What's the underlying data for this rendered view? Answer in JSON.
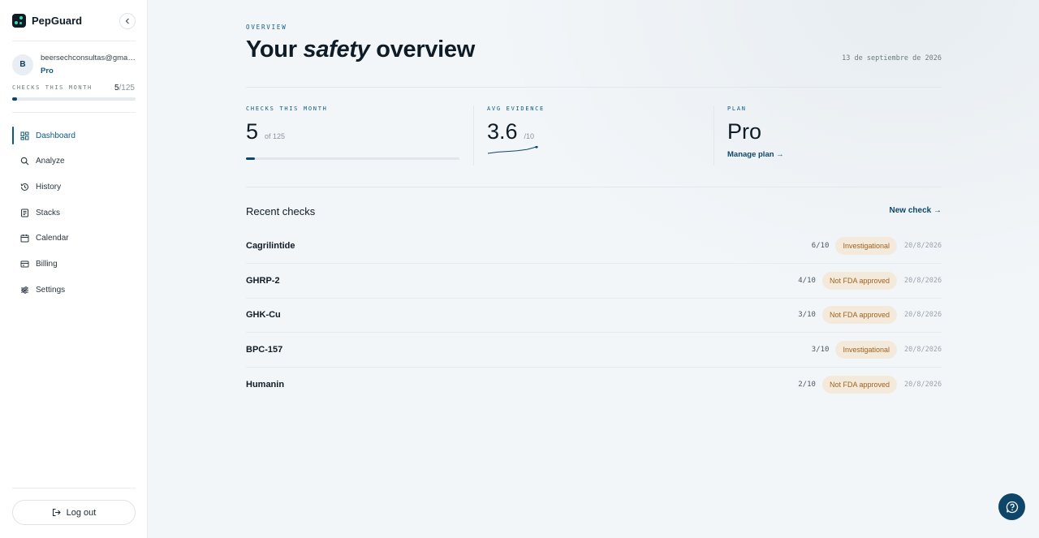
{
  "brand": {
    "name": "PepGuard"
  },
  "user": {
    "initial": "B",
    "email": "beersechconsultas@gmail.com",
    "plan": "Pro"
  },
  "sidebar": {
    "checks_label": "CHECKS THIS MONTH",
    "checks_used": "5",
    "checks_total": "/125",
    "checks_progress": 0.04,
    "nav": [
      {
        "label": "Dashboard",
        "icon": "grid-icon",
        "active": true
      },
      {
        "label": "Analyze",
        "icon": "search-icon",
        "active": false
      },
      {
        "label": "History",
        "icon": "history-icon",
        "active": false
      },
      {
        "label": "Stacks",
        "icon": "stack-icon",
        "active": false
      },
      {
        "label": "Calendar",
        "icon": "calendar-icon",
        "active": false
      },
      {
        "label": "Billing",
        "icon": "billing-icon",
        "active": false
      },
      {
        "label": "Settings",
        "icon": "settings-icon",
        "active": false
      }
    ],
    "logout_label": "Log out"
  },
  "header": {
    "eyebrow": "OVERVIEW",
    "title_pre": "Your",
    "title_em": "safety",
    "title_post": "overview",
    "date": "13 de septiembre de 2026"
  },
  "stats": {
    "checks": {
      "label": "CHECKS THIS MONTH",
      "value": "5",
      "sub": "of 125",
      "progress": 0.04
    },
    "evidence": {
      "label": "AVG EVIDENCE",
      "value": "3.6",
      "sub": "/10",
      "trend": [
        2.6,
        2.8,
        2.9,
        3.0,
        3.2,
        3.6
      ]
    },
    "plan": {
      "label": "PLAN",
      "value": "Pro",
      "link": "Manage plan →"
    }
  },
  "recent": {
    "title": "Recent checks",
    "new_check": "New check →",
    "rows": [
      {
        "name": "Cagrilintide",
        "score": "6/10",
        "status": "Investigational",
        "date": "20/8/2026"
      },
      {
        "name": "GHRP-2",
        "score": "4/10",
        "status": "Not FDA approved",
        "date": "20/8/2026"
      },
      {
        "name": "GHK-Cu",
        "score": "3/10",
        "status": "Not FDA approved",
        "date": "20/8/2026"
      },
      {
        "name": "BPC-157",
        "score": "3/10",
        "status": "Investigational",
        "date": "20/8/2026"
      },
      {
        "name": "Humanin",
        "score": "2/10",
        "status": "Not FDA approved",
        "date": "20/8/2026"
      }
    ]
  },
  "colors": {
    "accent": "#0d4668",
    "link": "#0d5a85",
    "badge_bg": "#f3eadc",
    "badge_text": "#a1621c"
  }
}
